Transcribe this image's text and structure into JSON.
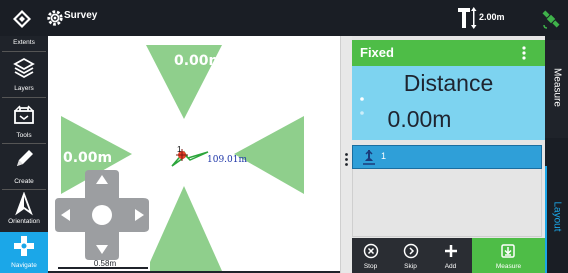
{
  "top_bar": {
    "app_logo_icon": "layers-diamond-icon",
    "mode_icon": "gear-icon",
    "mode_label": "Survey",
    "pole_icon": "pole-height-icon",
    "pole_height": "2.00m",
    "satellite_icon": "satellite-icon",
    "satellite_color": "#3fb24a"
  },
  "toolbar": {
    "items": [
      {
        "label": "Extents",
        "icon": "extents-icon"
      },
      {
        "label": "Layers",
        "icon": "layers-icon"
      },
      {
        "label": "Tools",
        "icon": "toolbox-icon"
      },
      {
        "label": "Create",
        "icon": "pencil-icon"
      },
      {
        "label": "Orientation",
        "icon": "north-arrow-icon"
      },
      {
        "label": "Navigate",
        "icon": "dpad-icon"
      }
    ],
    "active_item": "Navigate",
    "active_color": "#1ba7e8"
  },
  "map": {
    "targets": {
      "top": "0.00m",
      "left": "0.00m"
    },
    "point": {
      "number": "1",
      "distance": "109.01m"
    },
    "scale": "0.58m",
    "triangle_color": "#8fcf8c",
    "dpad_color": "#9c9ea1"
  },
  "panel": {
    "status": "Fixed",
    "status_color": "#4ebd47",
    "measure_title": "Distance",
    "measure_value": "0.00m",
    "points": [
      {
        "number": "1",
        "icon": "pin-icon"
      }
    ],
    "actions": [
      {
        "label": "Stop",
        "icon": "cancel-circle-icon"
      },
      {
        "label": "Skip",
        "icon": "skip-circle-icon"
      },
      {
        "label": "Add",
        "icon": "plus-icon"
      },
      {
        "label": "Measure",
        "icon": "measure-download-icon"
      }
    ]
  },
  "side_tabs": {
    "measure": "Measure",
    "layout": "Layout"
  }
}
